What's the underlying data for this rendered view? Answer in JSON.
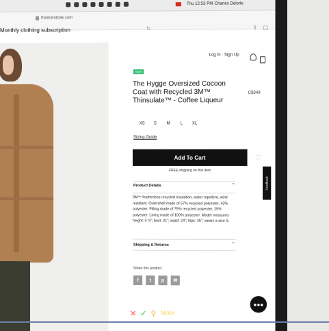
{
  "browser": {
    "url": "frankandoak.com",
    "clock": "Thu 12:53 PM",
    "user": "Charles Delorle",
    "tab_title": "Monthly clothing subscription"
  },
  "header": {
    "login": "Log In · Sign Up"
  },
  "product": {
    "badge": "NEW",
    "title": "The Hygge Oversized Cocoon Coat with Recycled 3M™ Thinsulate™ - Coffee Liqueur",
    "price": "C$349",
    "sizes": [
      "XS",
      "S",
      "M",
      "L",
      "XL"
    ],
    "sizing_guide": "Sizing Guide",
    "add_to_cart": "Add To Cart",
    "shipping": "FREE shipping on this item",
    "details_heading": "Product Details",
    "details_text": "3M™ featherless recycled insulation, water repellent, wind resistant. Outershell made of 57% recycled polyester, 43% polyester. Filling made of 75% recycled polyester, 25% polyester. Lining made of 100% polyester. Model measures height: 5' 9\"; bust: 31\"; waist: 24\"; hips: 35\"; wears a size S.",
    "shipping_heading": "Shipping & Returns",
    "share_label": "Share this product.",
    "social": [
      "f",
      "t",
      "p",
      "✉"
    ]
  },
  "widgets": {
    "feedback": "Feedback",
    "chat_icon": "chat-bubble-icon"
  },
  "overlay": {
    "note": "Note"
  }
}
